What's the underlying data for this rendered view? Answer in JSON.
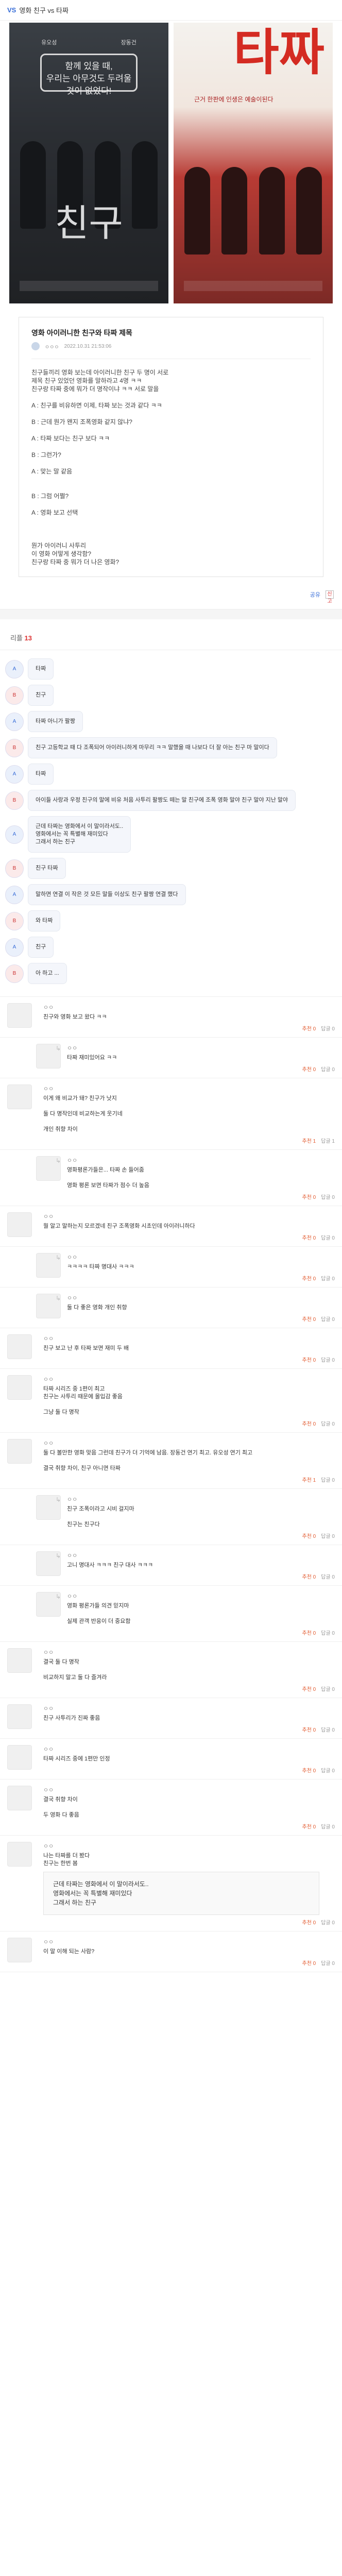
{
  "header": {
    "badge": "VS",
    "title": "영화 친구 vs 타짜"
  },
  "posters": [
    {
      "top_names": [
        "유오성",
        "장동건"
      ],
      "tagline": "함께 있을 때,\n우리는 아무것도 두려울 것이 없었다!",
      "big_title": "친구"
    },
    {
      "top_names": [
        "",
        ""
      ],
      "big_title": "타짜",
      "sub": "근거 한판에 인생은 예술이된다"
    }
  ],
  "post": {
    "title": "영화 아이러니한 친구와 타짜 제목",
    "meta_author": "ㅇㅇㅇ",
    "meta_date": "2022.10.31 21:53:06",
    "body": [
      "친구들끼리 영화 보는데 아이러니한 친구 두 명이 서로",
      "제목 친구 있었던 영화를 말하라고 4명 ㅋㅋ",
      "친구랑 타짜 중에 뭐가 더 명작이냐 ㅋㅋ 서로 말을",
      "",
      "A : 친구를 비유하면 이제, 타짜 보는 것과 같다 ㅋㅋ",
      "",
      "B : 근데 뭔가 왠지 조폭영화 같지 않냐?",
      "",
      "A : 타짜 보다는 친구 보다 ㅋㅋ",
      "",
      "B : 그런가?",
      "",
      "A : 맞는 말 같음",
      "",
      "",
      "B : 그럼 어쩔?",
      "",
      "A : 영화 보고 선택",
      "",
      "",
      "",
      "뭔가 아이러니 사투리",
      "이 영화 어떻게 생각함?",
      "친구랑 타짜 중 뭐가 더 나은 영화?"
    ]
  },
  "share": {
    "label": "공유",
    "report": "신고"
  },
  "reply_header": {
    "label": "리플",
    "count": "13"
  },
  "chat": [
    {
      "who": "A",
      "text": "타짜"
    },
    {
      "who": "B",
      "text": "친구"
    },
    {
      "who": "A",
      "text": "타짜 아니가 팔짱"
    },
    {
      "who": "B",
      "text": "친구 고등학교 때 다 조폭되어 아이러니하게 마무리 ㅋㅋ 말했을 때 나보다 더 잘 아는 친구 마 말이다"
    },
    {
      "who": "A",
      "text": "타짜"
    },
    {
      "who": "B",
      "text": "아이들 사랑과 우정 친구의 말에 비유 처음 사투리 팔짱도 떼는 말 친구에 조폭 영화 말야 친구 말야 지난 말야"
    },
    {
      "who": "A",
      "text": "근데 타짜는 영화에서 이 말이라서도..\n영화에서는 꼭 특별해 재미있다\n그래서 하는 친구"
    },
    {
      "who": "B",
      "text": "친구 타짜"
    },
    {
      "who": "A",
      "text": "말하면 연결 이 작은 것 모든 말들 이상도 친구 팔짱 연결 했다"
    },
    {
      "who": "B",
      "text": "와 타짜"
    },
    {
      "who": "A",
      "text": "친구"
    },
    {
      "who": "B",
      "text": "아 하고 ..."
    }
  ],
  "comments": [
    {
      "reply": false,
      "nick": "ㅇㅇ",
      "text": [
        "친구와 영화 보고 왔다 ㅋㅋ"
      ],
      "likes": "추천 0",
      "reps": "답글 0"
    },
    {
      "reply": true,
      "nick": "ㅇㅇ",
      "text": [
        "타짜 재미있어요 ㅋㅋ"
      ],
      "likes": "추천 0",
      "reps": "답글 0"
    },
    {
      "reply": false,
      "nick": "ㅇㅇ",
      "text": [
        "이게 왜 비교가 돼? 친구가 낫지",
        "",
        "둘 다 명작인데 비교하는게 웃기네",
        "",
        "개인 취향 차이"
      ],
      "likes": "추천 1",
      "reps": "답글 1"
    },
    {
      "reply": true,
      "nick": "ㅇㅇ",
      "text": [
        "영화평론가들은... 타짜 손 들어줌",
        "",
        "영화 평론 보면 타짜가 점수 더 높음"
      ],
      "likes": "추천 0",
      "reps": "답글 0"
    },
    {
      "reply": false,
      "nick": "ㅇㅇ",
      "text": [
        "뭘 알고 말하는지 모르겠네 친구 조폭영화 시초인데 아이러니하다"
      ],
      "likes": "추천 0",
      "reps": "답글 0"
    },
    {
      "reply": true,
      "nick": "ㅇㅇ",
      "text": [
        "ㅋㅋㅋㅋ 타짜 명대사 ㅋㅋㅋ"
      ],
      "likes": "추천 0",
      "reps": "답글 0"
    },
    {
      "reply": true,
      "nick": "ㅇㅇ",
      "text": [
        "둘 다 좋은 영화 개인 취향"
      ],
      "likes": "추천 0",
      "reps": "답글 0"
    },
    {
      "reply": false,
      "nick": "ㅇㅇ",
      "text": [
        "친구 보고 난 후 타짜 보면 재미 두 배"
      ],
      "likes": "추천 0",
      "reps": "답글 0"
    },
    {
      "reply": false,
      "nick": "ㅇㅇ",
      "text": [
        "타짜 시리즈 중 1편이 최고",
        "친구는 사투리 때문에 몰입감 좋음",
        "",
        "그냥 둘 다 명작"
      ],
      "likes": "추천 0",
      "reps": "답글 0"
    },
    {
      "reply": false,
      "nick": "ㅇㅇ",
      "text": [
        "둘 다 볼만한 영화 맞음 그런데 친구가 더 기억에 남음. 장동건 연기 최고. 유오성 연기 최고",
        "",
        "결국 취향 차이, 친구 아니면 타짜"
      ],
      "likes": "추천 1",
      "reps": "답글 0"
    },
    {
      "reply": true,
      "nick": "ㅇㅇ",
      "text": [
        "친구 조폭이라고 시비 걸지마",
        "",
        "친구는 친구다"
      ],
      "likes": "추천 0",
      "reps": "답글 0"
    },
    {
      "reply": true,
      "nick": "ㅇㅇ",
      "text": [
        "고니 명대사 ㅋㅋㅋ 친구 대사 ㅋㅋㅋ"
      ],
      "likes": "추천 0",
      "reps": "답글 0"
    },
    {
      "reply": true,
      "nick": "ㅇㅇ",
      "text": [
        "영화 평론가들 의견 믿지마",
        "",
        "실제 관객 반응이 더 중요함"
      ],
      "likes": "추천 0",
      "reps": "답글 0"
    },
    {
      "reply": false,
      "nick": "ㅇㅇ",
      "text": [
        "결국 둘 다 명작",
        "",
        "비교하지 말고 둘 다 즐겨라"
      ],
      "likes": "추천 0",
      "reps": "답글 0"
    },
    {
      "reply": false,
      "nick": "ㅇㅇ",
      "text": [
        "친구 사투리가 진짜 좋음"
      ],
      "likes": "추천 0",
      "reps": "답글 0"
    },
    {
      "reply": false,
      "nick": "ㅇㅇ",
      "text": [
        "타짜 시리즈 중에 1편만 인정"
      ],
      "likes": "추천 0",
      "reps": "답글 0"
    },
    {
      "reply": false,
      "nick": "ㅇㅇ",
      "text": [
        "결국 취향 차이",
        "",
        "두 영화 다 좋음"
      ],
      "likes": "추천 0",
      "reps": "답글 0"
    },
    {
      "reply": false,
      "nick": "ㅇㅇ",
      "text": [
        "나는 타짜를 더 봤다",
        "친구는 한번 봄"
      ],
      "quote": "근데 타짜는 영화에서 이 말이라서도..\n영화에서는 꼭 특별해 재미있다\n그래서 하는 친구",
      "likes": "추천 0",
      "reps": "답글 0"
    },
    {
      "reply": false,
      "nick": "ㅇㅇ",
      "text": [
        "이 말 이해 되는 사람?"
      ],
      "likes": "추천 0",
      "reps": "답글 0"
    }
  ]
}
